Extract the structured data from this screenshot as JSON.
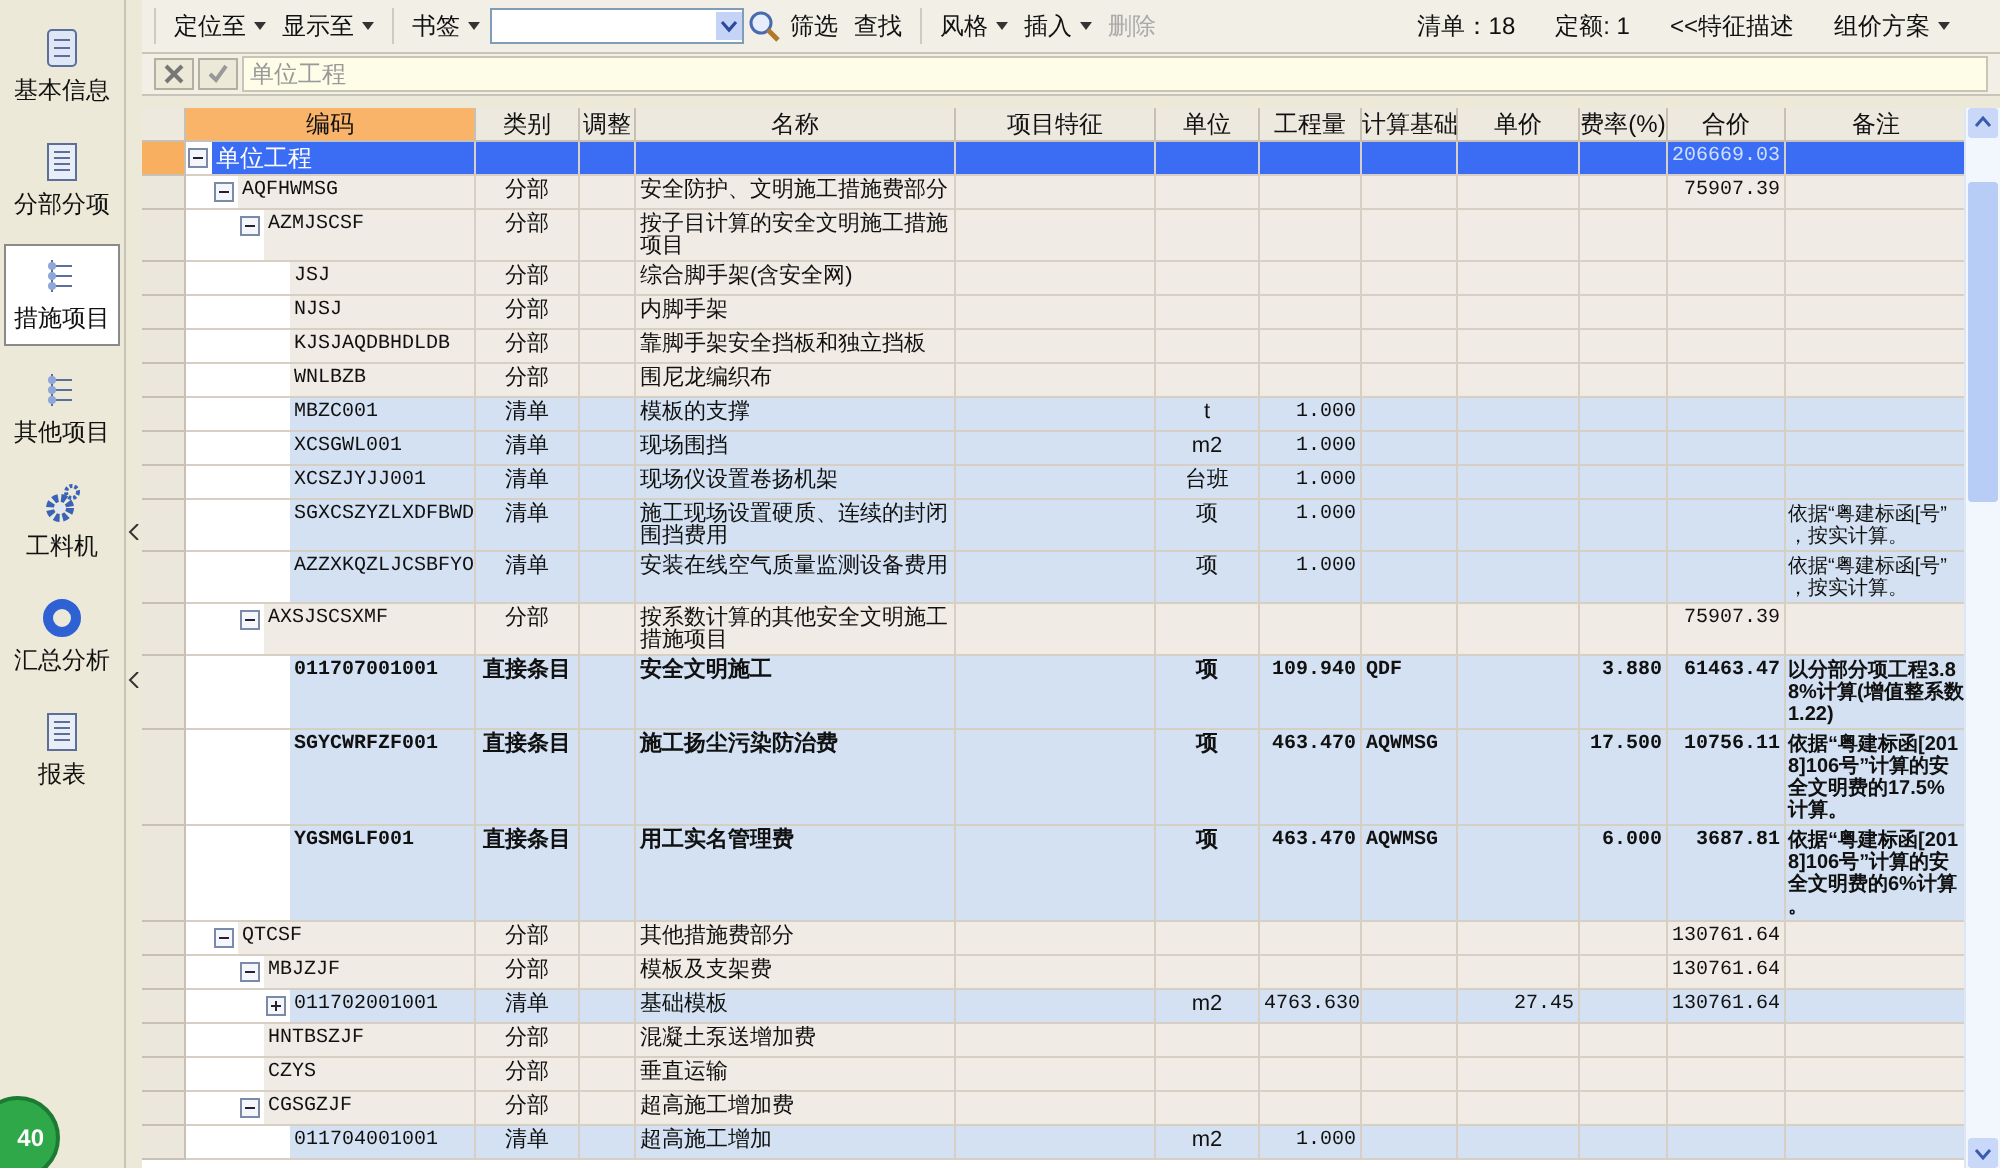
{
  "sidebar": {
    "items": [
      {
        "label": "基本信息",
        "selected": false
      },
      {
        "label": "分部分项",
        "selected": false
      },
      {
        "label": "措施项目",
        "selected": true
      },
      {
        "label": "其他项目",
        "selected": false
      },
      {
        "label": "工料机",
        "selected": false
      },
      {
        "label": "汇总分析",
        "selected": false
      },
      {
        "label": "报表",
        "selected": false
      }
    ]
  },
  "toolbar": {
    "groups": [
      [
        {
          "kind": "dropdown",
          "label": "定位至",
          "disabled": false
        },
        {
          "kind": "dropdown",
          "label": "显示至",
          "disabled": false
        }
      ],
      [
        {
          "kind": "dropdown",
          "label": "书签",
          "disabled": false
        },
        {
          "kind": "combo"
        },
        {
          "kind": "search"
        },
        {
          "kind": "button",
          "label": "筛选",
          "disabled": false
        },
        {
          "kind": "button",
          "label": "查找",
          "disabled": false
        }
      ],
      [
        {
          "kind": "dropdown",
          "label": "风格",
          "disabled": false
        },
        {
          "kind": "dropdown",
          "label": "插入",
          "disabled": false
        },
        {
          "kind": "button",
          "label": "删除",
          "disabled": true
        }
      ]
    ],
    "status": [
      {
        "kind": "label",
        "label": "清单：18"
      },
      {
        "kind": "label",
        "label": "定额: 1"
      },
      {
        "kind": "button",
        "label": "<<特征描述",
        "disabled": false
      },
      {
        "kind": "dropdown",
        "label": "组价方案",
        "disabled": false
      }
    ]
  },
  "edit_bar": {
    "value": "单位工程"
  },
  "table": {
    "columns": [
      "编码",
      "类别",
      "调整",
      "名称",
      "项目特征",
      "单位",
      "工程量",
      "计算基础",
      "单价",
      "费率(%)",
      "合价",
      "备注"
    ],
    "rows": [
      {
        "code": "单位工程",
        "total": "206669.03",
        "selected": true,
        "expanded": true,
        "children": [
          {
            "kind": "fenbu",
            "code": "AQFHWMSG",
            "type": "分部",
            "name": "安全防护、文明施工措施费部分",
            "total": "75907.39",
            "selected": false,
            "expanded": true,
            "children": [
              {
                "kind": "fenbu",
                "code": "AZMJSCSF",
                "type": "分部",
                "name": "按子目计算的安全文明施工措施项目",
                "selected": false,
                "expanded": true,
                "children": [
                  {
                    "kind": "fenbu",
                    "code": "JSJ",
                    "type": "分部",
                    "name": "综合脚手架(含安全网)",
                    "selected": false
                  },
                  {
                    "kind": "fenbu",
                    "code": "NJSJ",
                    "type": "分部",
                    "name": "内脚手架",
                    "selected": false
                  },
                  {
                    "kind": "fenbu",
                    "code": "KJSJAQDBHDLDB",
                    "type": "分部",
                    "name": "靠脚手架安全挡板和独立挡板",
                    "selected": false
                  },
                  {
                    "kind": "fenbu",
                    "code": "WNLBZB",
                    "type": "分部",
                    "name": "围尼龙编织布",
                    "selected": false
                  },
                  {
                    "kind": "qingdan",
                    "code": "MBZC001",
                    "type": "清单",
                    "name": "模板的支撑",
                    "unit": "t",
                    "qty": "1.000",
                    "selected": false
                  },
                  {
                    "kind": "qingdan",
                    "code": "XCSGWL001",
                    "type": "清单",
                    "name": "现场围挡",
                    "unit": "m2",
                    "qty": "1.000",
                    "selected": false
                  },
                  {
                    "kind": "qingdan",
                    "code": "XCSZJYJJ001",
                    "type": "清单",
                    "name": "现场仪设置卷扬机架",
                    "unit": "台班",
                    "qty": "1.000",
                    "selected": false
                  },
                  {
                    "kind": "qingdan",
                    "code": "SGXCSZYZLXDFBWD",
                    "type": "清单",
                    "name": "施工现场设置硬质、连续的封闭围挡费用",
                    "unit": "项",
                    "qty": "1.000",
                    "note": "依据“粤建标函[号”，按实计算。",
                    "selected": false
                  },
                  {
                    "kind": "qingdan",
                    "code": "AZZXKQZLJCSBFYO",
                    "type": "清单",
                    "name": "安装在线空气质量监测设备费用",
                    "unit": "项",
                    "qty": "1.000",
                    "note": "依据“粤建标函[号”，按实计算。",
                    "selected": false
                  }
                ]
              },
              {
                "kind": "fenbu",
                "code": "AXSJSCSXMF",
                "type": "分部",
                "name": "按系数计算的其他安全文明施工措施项目",
                "total": "75907.39",
                "selected": false,
                "expanded": true,
                "children": [
                  {
                    "kind": "direct",
                    "code": "011707001001",
                    "type": "直接条目",
                    "name": "安全文明施工",
                    "unit": "项",
                    "qty": "109.940",
                    "base": "QDF",
                    "rate": "3.880",
                    "total": "61463.47",
                    "note": "以分部分项工程3.88%计算(增值整系数1.22)",
                    "selected": false
                  },
                  {
                    "kind": "direct",
                    "code": "SGYCWRFZF001",
                    "type": "直接条目",
                    "name": "施工扬尘污染防治费",
                    "unit": "项",
                    "qty": "463.470",
                    "base": "AQWMSG",
                    "rate": "17.500",
                    "total": "10756.11",
                    "note": "依据“粤建标函[2018]106号”计算的安全文明费的17.5%计算。",
                    "selected": false
                  },
                  {
                    "kind": "direct",
                    "code": "YGSMGLF001",
                    "type": "直接条目",
                    "name": "用工实名管理费",
                    "unit": "项",
                    "qty": "463.470",
                    "base": "AQWMSG",
                    "rate": "6.000",
                    "total": "3687.81",
                    "note": "依据“粤建标函[2018]106号”计算的安全文明费的6%计算。",
                    "selected": false
                  }
                ]
              }
            ]
          },
          {
            "kind": "fenbu",
            "code": "QTCSF",
            "type": "分部",
            "name": "其他措施费部分",
            "total": "130761.64",
            "selected": false,
            "expanded": true,
            "children": [
              {
                "kind": "fenbu",
                "code": "MBJZJF",
                "type": "分部",
                "name": "模板及支架费",
                "total": "130761.64",
                "selected": false,
                "expanded": true,
                "children": [
                  {
                    "kind": "qingdan",
                    "code": "011702001001",
                    "type": "清单",
                    "name": "基础模板",
                    "unit": "m2",
                    "qty": "4763.630",
                    "price": "27.45",
                    "total": "130761.64",
                    "selected": false,
                    "expanded": false
                  }
                ]
              },
              {
                "kind": "fenbu",
                "code": "HNTBSZJF",
                "type": "分部",
                "name": "混凝土泵送增加费",
                "selected": false
              },
              {
                "kind": "fenbu",
                "code": "CZYS",
                "type": "分部",
                "name": "垂直运输",
                "selected": false
              },
              {
                "kind": "fenbu",
                "code": "CGSGZJF",
                "type": "分部",
                "name": "超高施工增加费",
                "selected": false,
                "expanded": true,
                "children": [
                  {
                    "kind": "qingdan",
                    "code": "011704001001",
                    "type": "清单",
                    "name": "超高施工增加",
                    "unit": "m2",
                    "qty": "1.000",
                    "selected": false
                  }
                ]
              }
            ]
          }
        ]
      }
    ]
  },
  "badge": {
    "text": "40"
  }
}
